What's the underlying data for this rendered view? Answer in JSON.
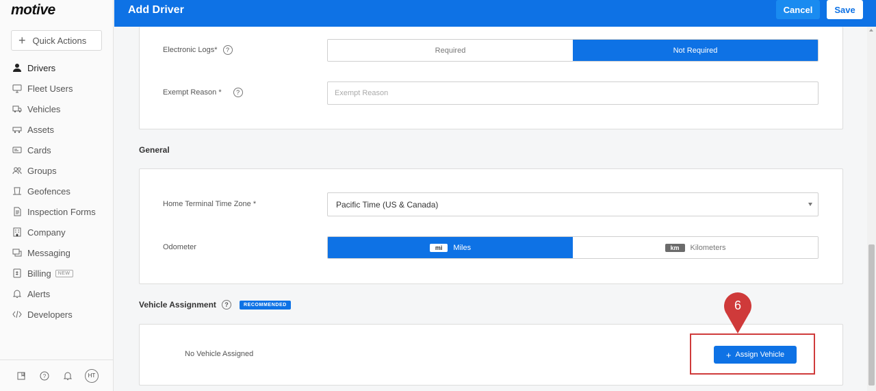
{
  "app": {
    "logo": "motive"
  },
  "sidebar": {
    "quick_actions": "Quick Actions",
    "items": [
      {
        "label": "Drivers",
        "icon": "person-icon",
        "active": true
      },
      {
        "label": "Fleet Users",
        "icon": "monitor-icon"
      },
      {
        "label": "Vehicles",
        "icon": "truck-icon"
      },
      {
        "label": "Assets",
        "icon": "trailer-icon"
      },
      {
        "label": "Cards",
        "icon": "card-icon"
      },
      {
        "label": "Groups",
        "icon": "users-icon"
      },
      {
        "label": "Geofences",
        "icon": "geofence-icon"
      },
      {
        "label": "Inspection Forms",
        "icon": "document-icon"
      },
      {
        "label": "Company",
        "icon": "building-icon"
      },
      {
        "label": "Messaging",
        "icon": "chat-icon"
      },
      {
        "label": "Billing",
        "icon": "receipt-icon",
        "badge": "NEW"
      },
      {
        "label": "Alerts",
        "icon": "bell-icon"
      },
      {
        "label": "Developers",
        "icon": "code-icon"
      }
    ],
    "bottom": {
      "avatar_initials": "HT"
    }
  },
  "header": {
    "title": "Add Driver",
    "cancel_label": "Cancel",
    "save_label": "Save"
  },
  "logs": {
    "electronic_logs_label": "Electronic Logs*",
    "options": [
      "Required",
      "Not Required"
    ],
    "selected": "Not Required",
    "exempt_label": "Exempt Reason *",
    "exempt_placeholder": "Exempt Reason"
  },
  "general": {
    "title": "General",
    "timezone_label": "Home Terminal Time Zone *",
    "timezone_value": "Pacific Time (US & Canada)",
    "odometer_label": "Odometer",
    "miles_unit": "mi",
    "miles_label": "Miles",
    "km_unit": "km",
    "km_label": "Kilometers",
    "selected": "Miles"
  },
  "vehicle": {
    "title": "Vehicle Assignment",
    "badge": "RECOMMENDED",
    "empty_text": "No Vehicle Assigned",
    "assign_label": "Assign Vehicle"
  },
  "annotation": {
    "step_number": "6",
    "color": "#cf3a3a"
  },
  "colors": {
    "primary": "#0e72e5",
    "cancel": "#1a8bf0"
  }
}
